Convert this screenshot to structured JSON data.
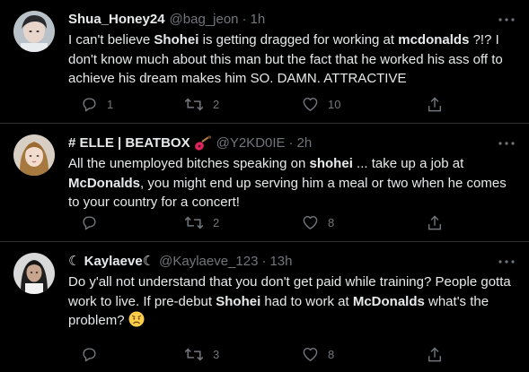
{
  "tweets": [
    {
      "name": "Shua_Honey24",
      "handle": "@bag_jeon",
      "separator": "·",
      "time": "1h",
      "text_parts": [
        {
          "t": "I can't believe ",
          "b": false
        },
        {
          "t": "Shohei",
          "b": true
        },
        {
          "t": " is getting dragged for working at ",
          "b": false
        },
        {
          "t": "mcdonalds",
          "b": true
        },
        {
          "t": " ?!? I don't know much about this man but the fact that he worked his ass off to achieve his dream makes him SO. DAMN. ATTRACTIVE",
          "b": false
        }
      ],
      "replies": "1",
      "retweets": "2",
      "likes": "10"
    },
    {
      "name": "# ELLE | BEATBOX",
      "name_emoji": "guitar-icon",
      "handle": "@Y2KD0IE",
      "separator": "·",
      "time": "2h",
      "text_parts": [
        {
          "t": "All the unemployed bitches speaking on ",
          "b": false
        },
        {
          "t": "shohei",
          "b": true
        },
        {
          "t": " ... take up a job at ",
          "b": false
        },
        {
          "t": "McDonalds",
          "b": true
        },
        {
          "t": ", you might end up serving him a meal or two when he comes to your country for a concert!",
          "b": false
        }
      ],
      "replies": "",
      "retweets": "2",
      "likes": "8"
    },
    {
      "name": "☾ Kaylaeve☾",
      "handle": "@Kaylaeve_123",
      "separator": "·",
      "time": "13h",
      "text_parts": [
        {
          "t": "Do y'all not understand that you don't get paid while training? People gotta work to live. If pre-debut ",
          "b": false
        },
        {
          "t": "Shohei",
          "b": true
        },
        {
          "t": " had to work at ",
          "b": false
        },
        {
          "t": "McDonalds",
          "b": true
        },
        {
          "t": " what's the problem? ",
          "b": false
        }
      ],
      "text_emoji": "worried-face-icon",
      "replies": "",
      "retweets": "3",
      "likes": "8"
    }
  ],
  "colors": {
    "background": "#000000",
    "text": "#e7e9ea",
    "muted": "#71767b",
    "divider": "#2f3336"
  }
}
